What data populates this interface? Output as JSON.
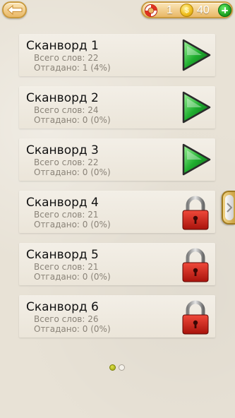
{
  "header": {
    "back_icon": "arrow-left-icon",
    "hints_icon": "lifebuoy-icon",
    "hints_count": "1",
    "coins_icon": "coin-icon",
    "coins_symbol": "$",
    "coins_count": "40",
    "add_icon": "plus-icon"
  },
  "crosswords": [
    {
      "title": "Сканворд 1",
      "total": "Всего слов: 22",
      "solved": "Отгадано: 1 (4%)",
      "state": "unlocked"
    },
    {
      "title": "Сканворд 2",
      "total": "Всего слов: 24",
      "solved": "Отгадано: 0 (0%)",
      "state": "unlocked"
    },
    {
      "title": "Сканворд 3",
      "total": "Всего слов: 22",
      "solved": "Отгадано: 0 (0%)",
      "state": "unlocked"
    },
    {
      "title": "Сканворд 4",
      "total": "Всего слов: 21",
      "solved": "Отгадано: 0 (0%)",
      "state": "locked"
    },
    {
      "title": "Сканворд 5",
      "total": "Всего слов: 21",
      "solved": "Отгадано: 0 (0%)",
      "state": "locked"
    },
    {
      "title": "Сканворд 6",
      "total": "Всего слов: 26",
      "solved": "Отгадано: 0 (0%)",
      "state": "locked"
    }
  ],
  "pager": {
    "pages": 2,
    "current": 1
  },
  "colors": {
    "play_green": "#1fae2f",
    "lock_red": "#d9261c",
    "accent_gold": "#e9b867"
  }
}
